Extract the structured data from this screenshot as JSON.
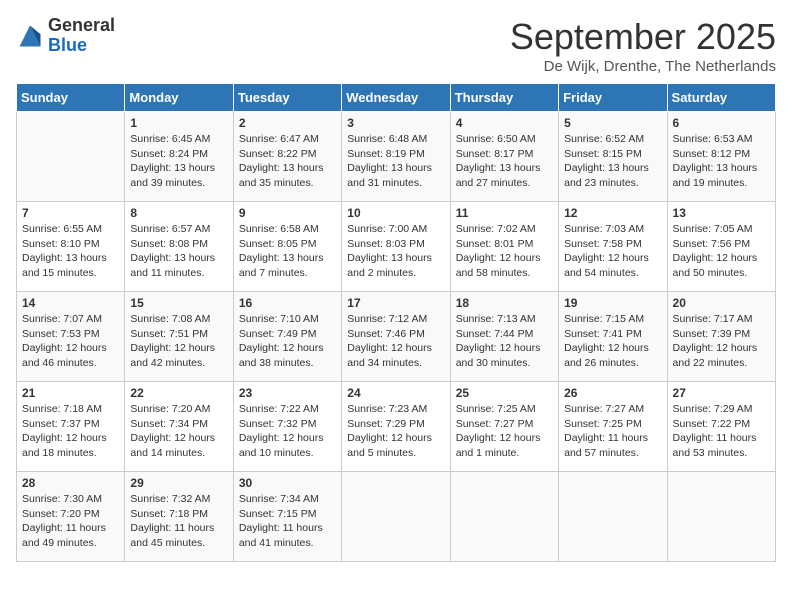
{
  "logo": {
    "general": "General",
    "blue": "Blue"
  },
  "title": "September 2025",
  "subtitle": "De Wijk, Drenthe, The Netherlands",
  "days_of_week": [
    "Sunday",
    "Monday",
    "Tuesday",
    "Wednesday",
    "Thursday",
    "Friday",
    "Saturday"
  ],
  "weeks": [
    [
      {
        "day": "",
        "info": ""
      },
      {
        "day": "1",
        "info": "Sunrise: 6:45 AM\nSunset: 8:24 PM\nDaylight: 13 hours\nand 39 minutes."
      },
      {
        "day": "2",
        "info": "Sunrise: 6:47 AM\nSunset: 8:22 PM\nDaylight: 13 hours\nand 35 minutes."
      },
      {
        "day": "3",
        "info": "Sunrise: 6:48 AM\nSunset: 8:19 PM\nDaylight: 13 hours\nand 31 minutes."
      },
      {
        "day": "4",
        "info": "Sunrise: 6:50 AM\nSunset: 8:17 PM\nDaylight: 13 hours\nand 27 minutes."
      },
      {
        "day": "5",
        "info": "Sunrise: 6:52 AM\nSunset: 8:15 PM\nDaylight: 13 hours\nand 23 minutes."
      },
      {
        "day": "6",
        "info": "Sunrise: 6:53 AM\nSunset: 8:12 PM\nDaylight: 13 hours\nand 19 minutes."
      }
    ],
    [
      {
        "day": "7",
        "info": "Sunrise: 6:55 AM\nSunset: 8:10 PM\nDaylight: 13 hours\nand 15 minutes."
      },
      {
        "day": "8",
        "info": "Sunrise: 6:57 AM\nSunset: 8:08 PM\nDaylight: 13 hours\nand 11 minutes."
      },
      {
        "day": "9",
        "info": "Sunrise: 6:58 AM\nSunset: 8:05 PM\nDaylight: 13 hours\nand 7 minutes."
      },
      {
        "day": "10",
        "info": "Sunrise: 7:00 AM\nSunset: 8:03 PM\nDaylight: 13 hours\nand 2 minutes."
      },
      {
        "day": "11",
        "info": "Sunrise: 7:02 AM\nSunset: 8:01 PM\nDaylight: 12 hours\nand 58 minutes."
      },
      {
        "day": "12",
        "info": "Sunrise: 7:03 AM\nSunset: 7:58 PM\nDaylight: 12 hours\nand 54 minutes."
      },
      {
        "day": "13",
        "info": "Sunrise: 7:05 AM\nSunset: 7:56 PM\nDaylight: 12 hours\nand 50 minutes."
      }
    ],
    [
      {
        "day": "14",
        "info": "Sunrise: 7:07 AM\nSunset: 7:53 PM\nDaylight: 12 hours\nand 46 minutes."
      },
      {
        "day": "15",
        "info": "Sunrise: 7:08 AM\nSunset: 7:51 PM\nDaylight: 12 hours\nand 42 minutes."
      },
      {
        "day": "16",
        "info": "Sunrise: 7:10 AM\nSunset: 7:49 PM\nDaylight: 12 hours\nand 38 minutes."
      },
      {
        "day": "17",
        "info": "Sunrise: 7:12 AM\nSunset: 7:46 PM\nDaylight: 12 hours\nand 34 minutes."
      },
      {
        "day": "18",
        "info": "Sunrise: 7:13 AM\nSunset: 7:44 PM\nDaylight: 12 hours\nand 30 minutes."
      },
      {
        "day": "19",
        "info": "Sunrise: 7:15 AM\nSunset: 7:41 PM\nDaylight: 12 hours\nand 26 minutes."
      },
      {
        "day": "20",
        "info": "Sunrise: 7:17 AM\nSunset: 7:39 PM\nDaylight: 12 hours\nand 22 minutes."
      }
    ],
    [
      {
        "day": "21",
        "info": "Sunrise: 7:18 AM\nSunset: 7:37 PM\nDaylight: 12 hours\nand 18 minutes."
      },
      {
        "day": "22",
        "info": "Sunrise: 7:20 AM\nSunset: 7:34 PM\nDaylight: 12 hours\nand 14 minutes."
      },
      {
        "day": "23",
        "info": "Sunrise: 7:22 AM\nSunset: 7:32 PM\nDaylight: 12 hours\nand 10 minutes."
      },
      {
        "day": "24",
        "info": "Sunrise: 7:23 AM\nSunset: 7:29 PM\nDaylight: 12 hours\nand 5 minutes."
      },
      {
        "day": "25",
        "info": "Sunrise: 7:25 AM\nSunset: 7:27 PM\nDaylight: 12 hours\nand 1 minute."
      },
      {
        "day": "26",
        "info": "Sunrise: 7:27 AM\nSunset: 7:25 PM\nDaylight: 11 hours\nand 57 minutes."
      },
      {
        "day": "27",
        "info": "Sunrise: 7:29 AM\nSunset: 7:22 PM\nDaylight: 11 hours\nand 53 minutes."
      }
    ],
    [
      {
        "day": "28",
        "info": "Sunrise: 7:30 AM\nSunset: 7:20 PM\nDaylight: 11 hours\nand 49 minutes."
      },
      {
        "day": "29",
        "info": "Sunrise: 7:32 AM\nSunset: 7:18 PM\nDaylight: 11 hours\nand 45 minutes."
      },
      {
        "day": "30",
        "info": "Sunrise: 7:34 AM\nSunset: 7:15 PM\nDaylight: 11 hours\nand 41 minutes."
      },
      {
        "day": "",
        "info": ""
      },
      {
        "day": "",
        "info": ""
      },
      {
        "day": "",
        "info": ""
      },
      {
        "day": "",
        "info": ""
      }
    ]
  ]
}
